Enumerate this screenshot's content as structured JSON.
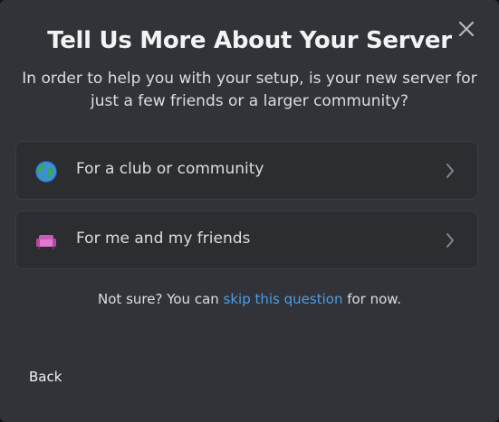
{
  "dialog": {
    "title": "Tell Us More About Your Server",
    "subtitle": "In order to help you with your setup, is your new server for just a few friends or a larger community?",
    "close_icon": "close-icon"
  },
  "options": [
    {
      "label": "For a club or community",
      "icon": "globe-icon"
    },
    {
      "label": "For me and my friends",
      "icon": "couch-icon"
    }
  ],
  "skip": {
    "prefix": "Not sure? You can ",
    "link": "skip this question",
    "suffix": " for now."
  },
  "footer": {
    "back_label": "Back"
  },
  "colors": {
    "background": "#313338",
    "option_border": "#3a3c42",
    "link": "#4e9ce8",
    "text": "#dbdee1",
    "heading": "#f2f3f5"
  }
}
